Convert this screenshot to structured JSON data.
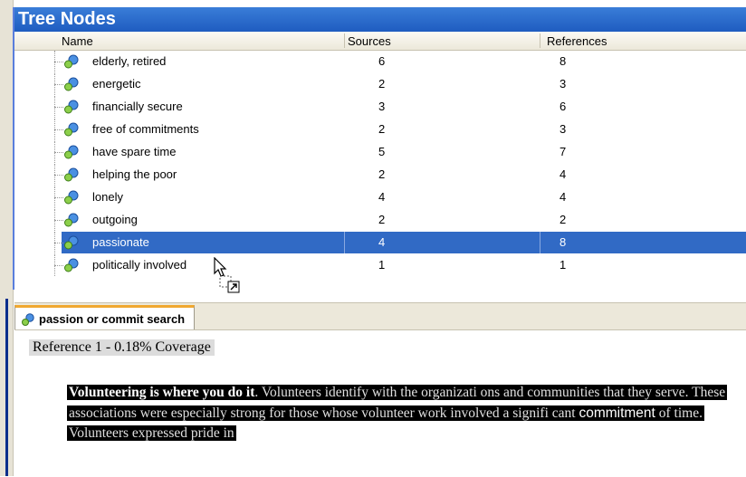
{
  "panel": {
    "title": "Tree Nodes"
  },
  "columns": {
    "name": "Name",
    "sources": "Sources",
    "references": "References"
  },
  "rows": [
    {
      "name": "elderly, retired",
      "sources": "6",
      "references": "8"
    },
    {
      "name": "energetic",
      "sources": "2",
      "references": "3"
    },
    {
      "name": "financially secure",
      "sources": "3",
      "references": "6"
    },
    {
      "name": "free of commitments",
      "sources": "2",
      "references": "3"
    },
    {
      "name": "have spare time",
      "sources": "5",
      "references": "7"
    },
    {
      "name": "helping the poor",
      "sources": "2",
      "references": "4"
    },
    {
      "name": "lonely",
      "sources": "4",
      "references": "4"
    },
    {
      "name": "outgoing",
      "sources": "2",
      "references": "2"
    },
    {
      "name": "passionate",
      "sources": "4",
      "references": "8",
      "selected": true
    },
    {
      "name": "politically involved",
      "sources": "1",
      "references": "1"
    }
  ],
  "tab": {
    "label": "passion or commit search",
    "icon": "tree-node-icon"
  },
  "document": {
    "reference_header": "Reference 1 - 0.18% Coverage",
    "lead_bold": "Volunteering is where you do it",
    "text_1": ". Volunteers identify with the organizati ons and communities that they serve. These associations were especially strong for those whose volunteer work involved a signifi cant ",
    "keyword": "commitment",
    "text_2": " of time. Volunteers expressed pride in"
  },
  "colors": {
    "title_bar": "#1f5cc0",
    "selection": "#316ac5",
    "tab_accent": "#f0a830"
  }
}
